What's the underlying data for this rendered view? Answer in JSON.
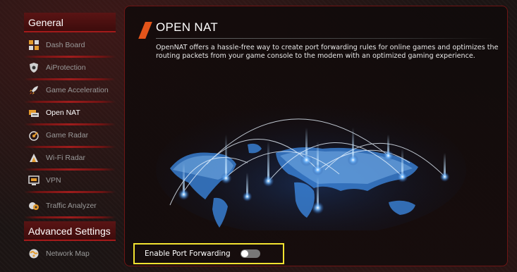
{
  "sidebar": {
    "general_header": "General",
    "advanced_header": "Advanced Settings",
    "items": [
      {
        "label": "Dash Board",
        "icon": "dashboard-icon"
      },
      {
        "label": "AiProtection",
        "icon": "shield-icon"
      },
      {
        "label": "Game Acceleration",
        "icon": "rocket-icon"
      },
      {
        "label": "Open NAT",
        "icon": "open-nat-icon",
        "active": true
      },
      {
        "label": "Game Radar",
        "icon": "radar-icon"
      },
      {
        "label": "Wi-Fi Radar",
        "icon": "wifi-radar-icon"
      },
      {
        "label": "VPN",
        "icon": "vpn-icon"
      },
      {
        "label": "Traffic Analyzer",
        "icon": "traffic-analyzer-icon"
      }
    ],
    "advanced_items": [
      {
        "label": "Network Map",
        "icon": "network-map-icon"
      }
    ]
  },
  "main": {
    "title": "OPEN NAT",
    "description": "OpenNAT offers a hassle-free way to create port forwarding rules for online games and optimizes the routing packets from your game console to the modem with an optimized gaming experience.",
    "port_forwarding": {
      "label": "Enable Port Forwarding",
      "enabled": false
    }
  },
  "colors": {
    "accent_red": "#a31a1a",
    "title_slash": "#e3541a",
    "highlight_box": "#f2e230"
  }
}
